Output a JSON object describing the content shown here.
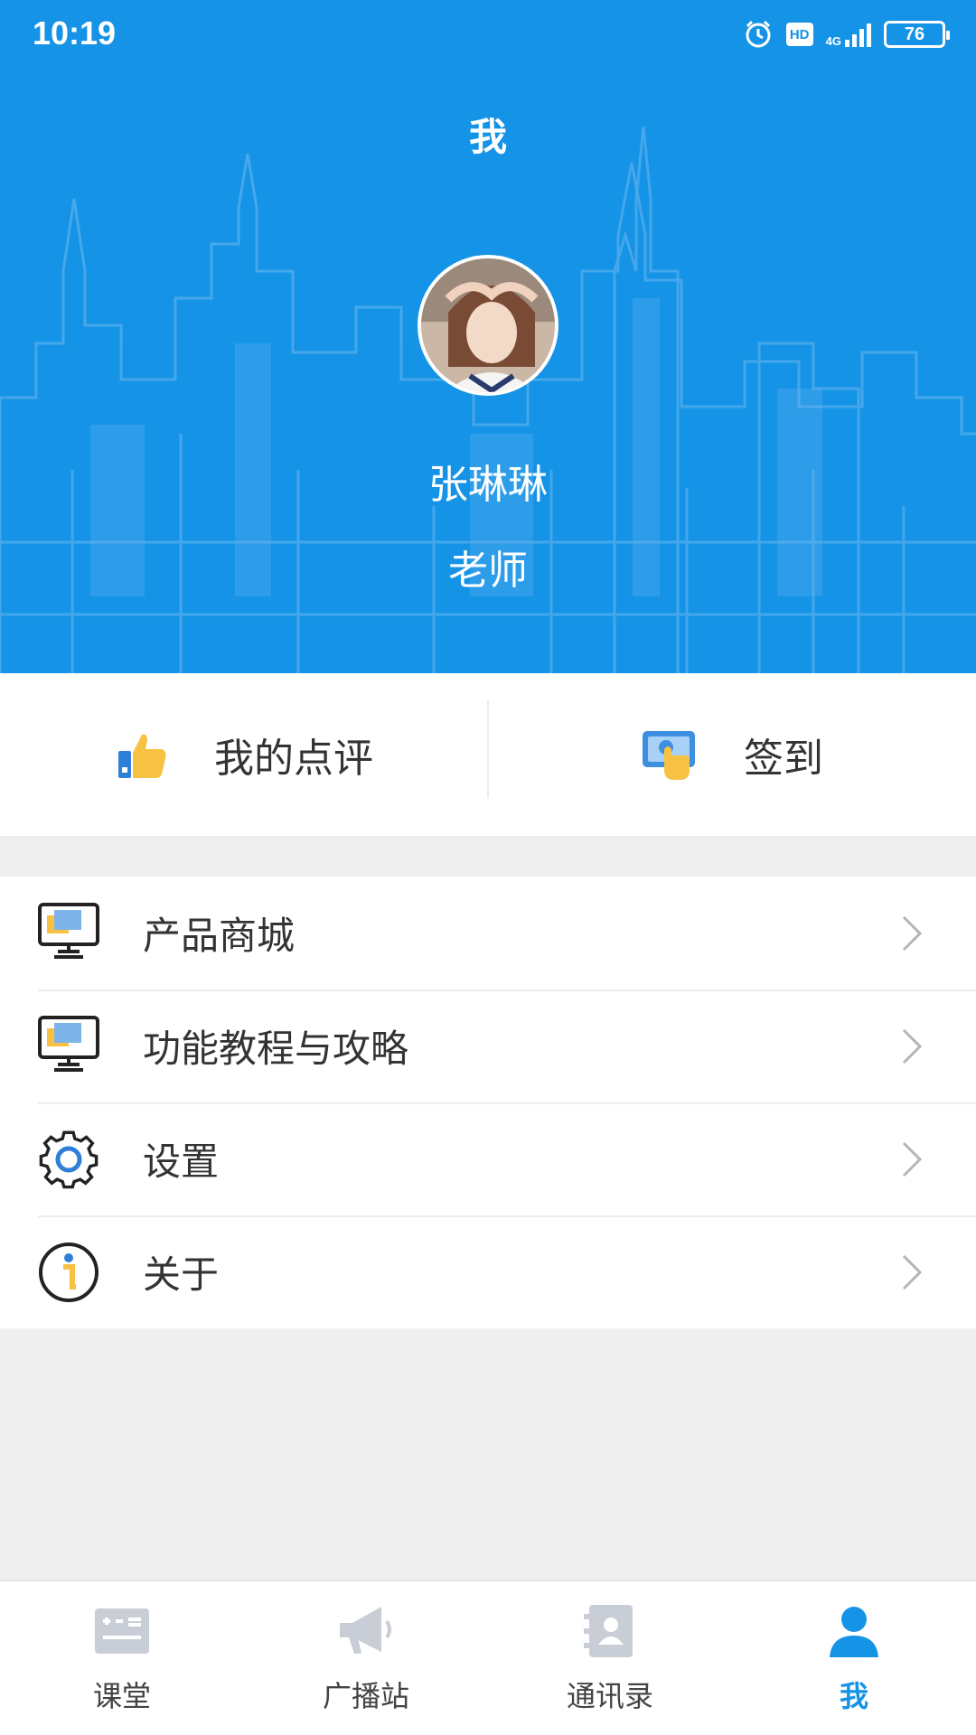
{
  "status_bar": {
    "time": "10:19",
    "network": "4G",
    "hd": "HD",
    "battery": "76",
    "icons": [
      "alarm-icon",
      "hd-icon",
      "signal-icon",
      "battery-icon"
    ]
  },
  "header": {
    "title": "我",
    "user": {
      "name": "张琳琳",
      "role": "老师"
    }
  },
  "actions": [
    {
      "label": "我的点评",
      "icon": "thumbs-up-icon"
    },
    {
      "label": "签到",
      "icon": "tap-sign-in-icon"
    }
  ],
  "menu": [
    {
      "label": "产品商城",
      "icon": "monitor-icon"
    },
    {
      "label": "功能教程与攻略",
      "icon": "monitor-icon"
    },
    {
      "label": "设置",
      "icon": "gear-icon"
    },
    {
      "label": "关于",
      "icon": "info-icon"
    }
  ],
  "tabs": [
    {
      "label": "课堂",
      "icon": "classroom-icon",
      "active": false
    },
    {
      "label": "广播站",
      "icon": "megaphone-icon",
      "active": false
    },
    {
      "label": "通讯录",
      "icon": "contacts-icon",
      "active": false
    },
    {
      "label": "我",
      "icon": "person-icon",
      "active": true
    }
  ],
  "colors": {
    "brand": "#1593e6",
    "icon_yellow": "#f7c244",
    "inactive": "#c9ced6"
  }
}
